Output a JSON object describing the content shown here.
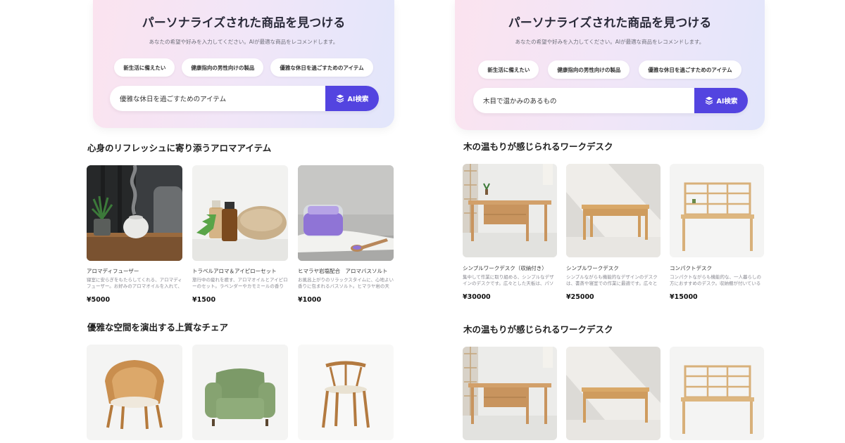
{
  "left": {
    "hero": {
      "title": "パーソナライズされた商品を見つける",
      "subtitle": "あなたの希望や好みを入力してください。AIが最適な商品をレコメンドします。",
      "chips": [
        "新生活に備えたい",
        "健康指向の男性向けの製品",
        "優雅な休日を過ごすためのアイテム"
      ],
      "search_value": "優雅な休日を過ごすためのアイテム",
      "search_button": "AI検索"
    },
    "section1": {
      "title": "心身のリフレッシュに寄り添うアロマアイテム",
      "products": [
        {
          "name": "アロマディフューザー",
          "desc": "寝室に安らぎをもたらしてくれる、アロマディフューザー。お好みのアロマオイルを入れて、リラックス空間を…",
          "price": "¥5000"
        },
        {
          "name": "トラベルアロマ＆アイピローセット",
          "desc": "旅行中の疲れを癒す、アロマオイルとアイピローのセット。ラベンダーやカモミールの香りが、リラックス効…",
          "price": "¥1500"
        },
        {
          "name": "ヒマラヤ岩塩配合　アロマバスソルト",
          "desc": "お風呂上がりのリラックスタイムに、心地よい香りに包まれるバスソルト。ヒマラヤ岩の天然岩塩を使…",
          "price": "¥1000"
        }
      ]
    },
    "section2": {
      "title": "優雅な空間を演出する上質なチェア"
    }
  },
  "right": {
    "hero": {
      "title": "パーソナライズされた商品を見つける",
      "subtitle": "あなたの希望や好みを入力してください。AIが最適な商品をレコメンドします。",
      "chips": [
        "新生活に備えたい",
        "健康指向の男性向けの製品",
        "優雅な休日を過ごすためのアイテム"
      ],
      "search_value": "木目で温かみのあるもの",
      "search_button": "AI検索"
    },
    "section1": {
      "title": "木の温もりが感じられるワークデスク",
      "products": [
        {
          "name": "シンプルワークデスク（収納付き）",
          "desc": "集中して作業に取り組める、シンプルなデザインのデスクです。広々とした天板は、パソコン作業や…",
          "price": "¥30000"
        },
        {
          "name": "シンプルワークデスク",
          "desc": "シンプルながらも機能的なデザインのデスクは、書斎や寝室での作業に最適です。広々とした天板…",
          "price": "¥25000"
        },
        {
          "name": "コンパクトデスク",
          "desc": "コンパクトながらも機能的な、一人暮らしの方におすすめのデスク。収納棚が付いているので、パソコ…",
          "price": "¥15000"
        }
      ]
    },
    "section2": {
      "title": "木の温もりが感じられるワークデスク"
    }
  },
  "colors": {
    "accent": "#5344e0",
    "hero_pink": "#fbe3ef",
    "hero_blue": "#e2e6fb"
  },
  "icons": {
    "search_button": "ai-sparkle-icon"
  }
}
